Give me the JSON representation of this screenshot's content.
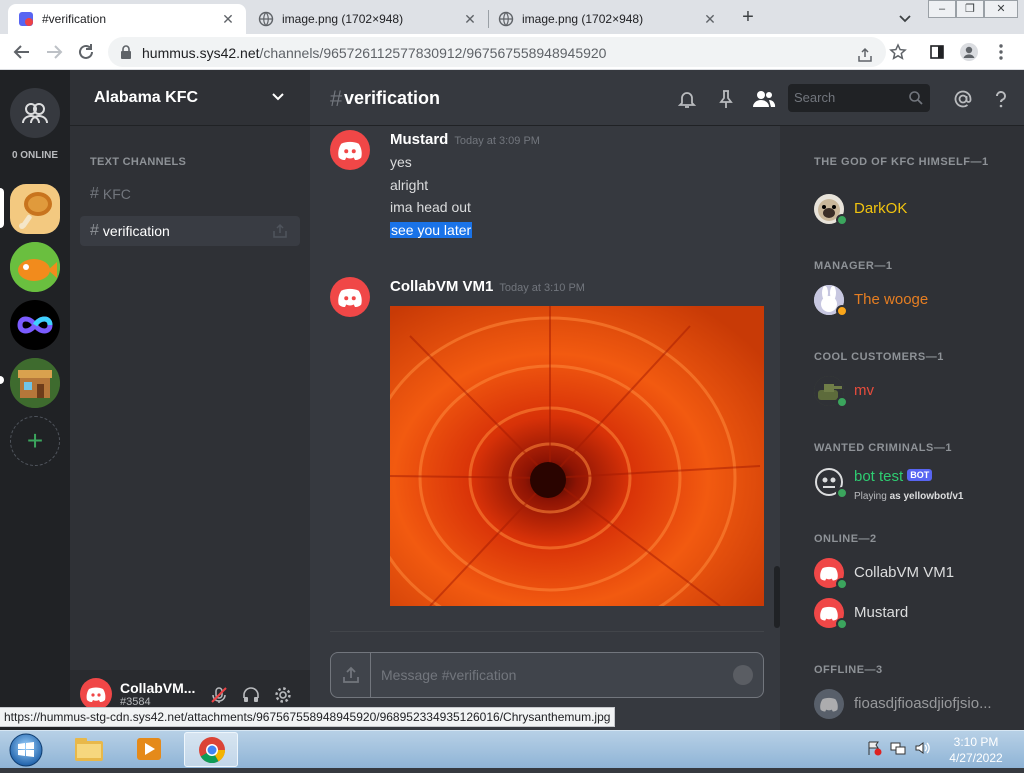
{
  "browser": {
    "tabs": [
      {
        "title": "#verification",
        "active": true
      },
      {
        "title": "image.png (1702×948)",
        "active": false
      },
      {
        "title": "image.png (1702×948)",
        "active": false
      }
    ],
    "url": {
      "host": "hummus.sys42.net",
      "path": "/channels/965726112577830912/967567558948945920"
    },
    "status_url": "https://hummus-stg-cdn.sys42.net/attachments/967567558948945920/968952334935126016/Chrysanthemum.jpg"
  },
  "servers": {
    "online_label": "0 ONLINE",
    "add_icon": "+"
  },
  "channels": {
    "guild_name": "Alabama KFC",
    "category": "TEXT CHANNELS",
    "items": [
      {
        "hash": "#",
        "name": "KFC"
      },
      {
        "hash": "#",
        "name": "verification"
      }
    ]
  },
  "user_panel": {
    "name": "CollabVM...",
    "tag": "#3584"
  },
  "chat": {
    "hash": "#",
    "channel": "verification",
    "search_placeholder": "Search",
    "messages": [
      {
        "author": "Mustard",
        "time": "Today at 3:09 PM",
        "lines": [
          "yes",
          "alright",
          "ima head out",
          "see you later"
        ]
      },
      {
        "author": "CollabVM VM1",
        "time": "Today at 3:10 PM",
        "attachment": "Chrysanthemum.jpg"
      }
    ],
    "composer_placeholder": "Message #verification"
  },
  "members": {
    "groups": [
      {
        "title": "THE GOD OF KFC HIMSELF",
        "count": "—1",
        "members": [
          {
            "name": "DarkOK",
            "color": "#f1c40f"
          }
        ]
      },
      {
        "title": "MANAGER—1",
        "members": [
          {
            "name": "The wooge",
            "color": "#e67e22"
          }
        ]
      },
      {
        "title": "COOL CUSTOMERS—1",
        "members": [
          {
            "name": "mv",
            "color": "#e74c3c"
          }
        ]
      },
      {
        "title": "WANTED CRIMINALS—1",
        "members": [
          {
            "name": "bot test",
            "color": "#2ecc71",
            "badge": "BOT",
            "activity_prefix": "Playing ",
            "activity": "as yellowbot/v1"
          }
        ]
      },
      {
        "title": "ONLINE—2",
        "members": [
          {
            "name": "CollabVM VM1",
            "color": "#dcddde"
          },
          {
            "name": "Mustard",
            "color": "#dcddde"
          }
        ]
      },
      {
        "title": "OFFLINE—3",
        "members": [
          {
            "name": "fioasdjfioasdjiofjsio...",
            "color": "#8e9297"
          }
        ]
      }
    ]
  },
  "taskbar": {
    "time": "3:10 PM",
    "date": "4/27/2022"
  },
  "colors": {
    "accent": "#5865f2",
    "online": "#3ba55d",
    "idle": "#faa61a",
    "discord_red": "#f04747"
  }
}
